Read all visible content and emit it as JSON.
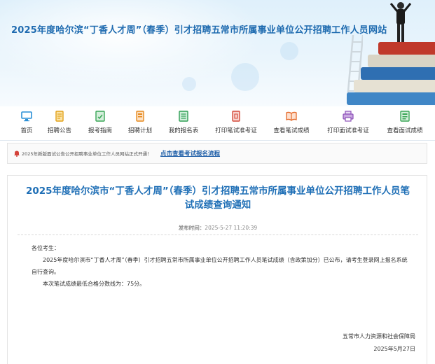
{
  "header": {
    "site_title": "2025年度哈尔滨“丁香人才周”（春季）引才招聘五常市所属事业单位公开招聘工作人员网站"
  },
  "nav": {
    "items": [
      {
        "label": "首页",
        "icon": "monitor-icon",
        "color": "#2a8fd6"
      },
      {
        "label": "招聘公告",
        "icon": "document-icon",
        "color": "#e2a21c"
      },
      {
        "label": "报考指南",
        "icon": "guide-icon",
        "color": "#3aa657"
      },
      {
        "label": "招聘计划",
        "icon": "plan-icon",
        "color": "#e58a1f"
      },
      {
        "label": "我的报名表",
        "icon": "form-icon",
        "color": "#2f9f55"
      },
      {
        "label": "打印笔试准考证",
        "icon": "print-icon",
        "color": "#d44a3a"
      },
      {
        "label": "查看笔试成绩",
        "icon": "book-icon",
        "color": "#e56a2a"
      },
      {
        "label": "打印面试准考证",
        "icon": "printer-icon",
        "color": "#8c4fb8"
      },
      {
        "label": "查看面试成绩",
        "icon": "score-icon",
        "color": "#3aa657"
      }
    ]
  },
  "notice": {
    "marquee": "2025年新版面试公告公开招聘事业单位工作人员网站正式开通！",
    "link": "点击查看考试报名流程"
  },
  "article": {
    "title": "2025年度哈尔滨市“丁香人才周”（春季）引才招聘五常市所属事业单位公开招聘工作人员笔试成绩查询通知",
    "pub_label": "发布时间：",
    "pub_date": "2025-5-27 11:20:39",
    "greeting": "各位考生：",
    "para1": "2025年度哈尔滨市“丁香人才周”（春季）引才招聘五常市所属事业单位公开招聘工作人员笔试成绩（含政策加分）已公布，请考生登录网上报名系统自行查询。",
    "para2": "本次笔试成绩最低合格分数线为：75分。",
    "signature": "五常市人力资源和社会保障局",
    "sign_date": "2025年5月27日"
  }
}
